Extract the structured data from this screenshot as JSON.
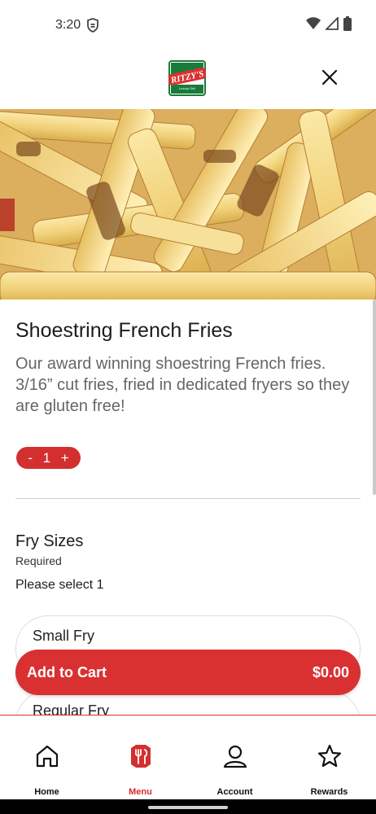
{
  "status_bar": {
    "time": "3:20"
  },
  "header": {
    "logo_text": "RITZY'S"
  },
  "item": {
    "title": "Shoestring French Fries",
    "description": "Our award winning shoestring French fries. 3/16” cut fries, fried in dedicated fryers so they are gluten free!",
    "quantity": {
      "minus": "-",
      "value": "1",
      "plus": "+"
    }
  },
  "modifier_group": {
    "title": "Fry Sizes",
    "required": "Required",
    "hint": "Please select 1",
    "options": [
      {
        "label": "Small Fry"
      },
      {
        "label": "Regular Fry"
      }
    ]
  },
  "cart": {
    "label": "Add to Cart",
    "price": "$0.00"
  },
  "bottom_nav": [
    {
      "label": "Home",
      "icon": "home-icon",
      "active": false
    },
    {
      "label": "Menu",
      "icon": "menu-icon",
      "active": true
    },
    {
      "label": "Account",
      "icon": "account-icon",
      "active": false
    },
    {
      "label": "Rewards",
      "icon": "star-icon",
      "active": false
    }
  ],
  "colors": {
    "brand_red": "#d93131",
    "logo_green": "#1a7a3a"
  }
}
